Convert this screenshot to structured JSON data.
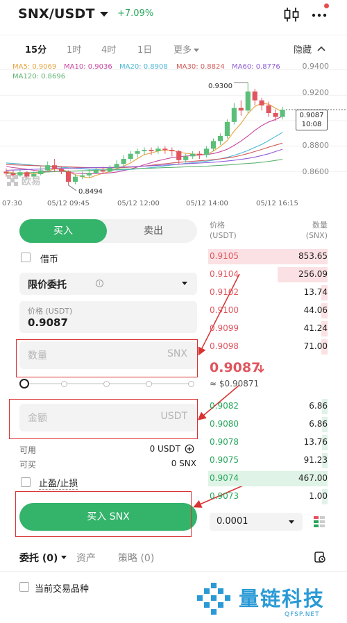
{
  "header": {
    "pair": "SNX/USDT",
    "change": "+7.09%",
    "colors": {
      "up": "#26a65b",
      "down": "#e0555e",
      "accent": "#34b36a"
    }
  },
  "timeframes": {
    "items": [
      "15分",
      "1时",
      "4时",
      "1日",
      "更多"
    ],
    "active": "15分",
    "hide_label": "隐藏"
  },
  "indicators": {
    "ma5": "MA5: 0.9069",
    "ma10": "MA10: 0.9036",
    "ma20": "MA20: 0.8908",
    "ma30": "MA30: 0.8824",
    "ma60": "MA60: 0.8776",
    "ma120": "MA120: 0.8696"
  },
  "chart_data": {
    "type": "candlestick",
    "price_ticks": [
      "0.9400",
      "0.9200",
      "0.9000",
      "0.8800",
      "0.8600"
    ],
    "time_ticks": [
      "07:30",
      "05/12 09:45",
      "05/12 12:00",
      "05/12 14:00",
      "05/12 16:15"
    ],
    "ylim": [
      0.84,
      0.948
    ],
    "high_label": "0.9300",
    "low_label": "0.8494",
    "current_price": "0.9087",
    "countdown": "10:08",
    "watermark": "欧易",
    "candles": [
      [
        0.86,
        0.8585,
        0.8625,
        0.856
      ],
      [
        0.8585,
        0.857,
        0.861,
        0.855
      ],
      [
        0.857,
        0.8595,
        0.862,
        0.856
      ],
      [
        0.8595,
        0.856,
        0.8605,
        0.854
      ],
      [
        0.856,
        0.858,
        0.86,
        0.8545
      ],
      [
        0.858,
        0.861,
        0.864,
        0.857
      ],
      [
        0.861,
        0.865,
        0.868,
        0.86
      ],
      [
        0.865,
        0.862,
        0.87,
        0.86
      ],
      [
        0.862,
        0.86,
        0.864,
        0.858
      ],
      [
        0.86,
        0.852,
        0.861,
        0.8494
      ],
      [
        0.852,
        0.856,
        0.858,
        0.85
      ],
      [
        0.856,
        0.857,
        0.86,
        0.854
      ],
      [
        0.857,
        0.859,
        0.862,
        0.855
      ],
      [
        0.859,
        0.861,
        0.863,
        0.858
      ],
      [
        0.861,
        0.86,
        0.864,
        0.858
      ],
      [
        0.86,
        0.863,
        0.865,
        0.859
      ],
      [
        0.863,
        0.866,
        0.869,
        0.861
      ],
      [
        0.866,
        0.87,
        0.873,
        0.864
      ],
      [
        0.87,
        0.874,
        0.876,
        0.868
      ],
      [
        0.874,
        0.876,
        0.878,
        0.871
      ],
      [
        0.876,
        0.877,
        0.879,
        0.873
      ],
      [
        0.877,
        0.876,
        0.879,
        0.873
      ],
      [
        0.876,
        0.878,
        0.88,
        0.874
      ],
      [
        0.878,
        0.877,
        0.88,
        0.874
      ],
      [
        0.877,
        0.876,
        0.879,
        0.872
      ],
      [
        0.876,
        0.869,
        0.877,
        0.866
      ],
      [
        0.869,
        0.872,
        0.874,
        0.867
      ],
      [
        0.872,
        0.874,
        0.876,
        0.87
      ],
      [
        0.874,
        0.873,
        0.876,
        0.87
      ],
      [
        0.873,
        0.878,
        0.88,
        0.871
      ],
      [
        0.878,
        0.884,
        0.886,
        0.876
      ],
      [
        0.884,
        0.888,
        0.89,
        0.881
      ],
      [
        0.888,
        0.899,
        0.901,
        0.886
      ],
      [
        0.899,
        0.91,
        0.914,
        0.897
      ],
      [
        0.91,
        0.908,
        0.916,
        0.904
      ],
      [
        0.908,
        0.923,
        0.93,
        0.906
      ],
      [
        0.923,
        0.916,
        0.925,
        0.912
      ],
      [
        0.916,
        0.912,
        0.918,
        0.908
      ],
      [
        0.912,
        0.906,
        0.915,
        0.903
      ],
      [
        0.906,
        0.903,
        0.909,
        0.9
      ],
      [
        0.903,
        0.9087,
        0.911,
        0.901
      ]
    ],
    "ma_lines": [
      {
        "color": "#e7a33e",
        "values": [
          0.86,
          0.859,
          0.8585,
          0.8585,
          0.8582,
          0.8583,
          0.8603,
          0.8622,
          0.8616,
          0.86,
          0.8574,
          0.856,
          0.855,
          0.857,
          0.8586,
          0.86,
          0.8622,
          0.8642,
          0.8668,
          0.8702,
          0.8734,
          0.8746,
          0.8762,
          0.8768,
          0.8768,
          0.8752,
          0.8744,
          0.8738,
          0.8736,
          0.8732,
          0.8762,
          0.8798,
          0.8844,
          0.8918,
          0.8978,
          0.9056,
          0.9112,
          0.9138,
          0.913,
          0.9098,
          0.9069
        ]
      },
      {
        "color": "#c845a0",
        "values": [
          0.864,
          0.8632,
          0.8625,
          0.8618,
          0.861,
          0.8604,
          0.86,
          0.8602,
          0.8603,
          0.8595,
          0.8588,
          0.8585,
          0.8582,
          0.8585,
          0.8586,
          0.859,
          0.8597,
          0.8608,
          0.862,
          0.8636,
          0.8654,
          0.867,
          0.8685,
          0.8698,
          0.871,
          0.8718,
          0.8722,
          0.8726,
          0.873,
          0.8734,
          0.8742,
          0.8756,
          0.8776,
          0.8806,
          0.884,
          0.888,
          0.8924,
          0.8962,
          0.899,
          0.901,
          0.9036
        ]
      },
      {
        "color": "#4bb7d6",
        "values": [
          0.8668,
          0.8664,
          0.866,
          0.8655,
          0.865,
          0.8646,
          0.8642,
          0.8638,
          0.8634,
          0.863,
          0.8626,
          0.8622,
          0.8618,
          0.8616,
          0.8614,
          0.8613,
          0.8613,
          0.8614,
          0.8617,
          0.8621,
          0.8626,
          0.8632,
          0.8638,
          0.8645,
          0.8652,
          0.8658,
          0.8664,
          0.867,
          0.8676,
          0.8682,
          0.869,
          0.87,
          0.8712,
          0.8728,
          0.8746,
          0.8766,
          0.879,
          0.8814,
          0.8844,
          0.8876,
          0.8908
        ]
      },
      {
        "color": "#d05a5a",
        "values": [
          0.8655,
          0.8653,
          0.8651,
          0.8649,
          0.8647,
          0.8645,
          0.8643,
          0.8641,
          0.8639,
          0.8637,
          0.8635,
          0.8633,
          0.8631,
          0.863,
          0.8629,
          0.8629,
          0.863,
          0.8632,
          0.8635,
          0.8639,
          0.8644,
          0.865,
          0.8656,
          0.8662,
          0.8668,
          0.8673,
          0.8677,
          0.8681,
          0.8685,
          0.8689,
          0.8694,
          0.87,
          0.8707,
          0.8716,
          0.8728,
          0.8742,
          0.8758,
          0.8774,
          0.8792,
          0.8808,
          0.8824
        ]
      },
      {
        "color": "#8f5ad6",
        "values": [
          0.861,
          0.8612,
          0.8614,
          0.8616,
          0.8618,
          0.862,
          0.8622,
          0.8624,
          0.8626,
          0.8627,
          0.8628,
          0.8629,
          0.863,
          0.8631,
          0.8632,
          0.8633,
          0.8634,
          0.8636,
          0.8638,
          0.864,
          0.8643,
          0.8646,
          0.8649,
          0.8652,
          0.8655,
          0.8658,
          0.8661,
          0.8664,
          0.8667,
          0.867,
          0.8674,
          0.8678,
          0.8683,
          0.8689,
          0.8696,
          0.8704,
          0.8714,
          0.8726,
          0.874,
          0.8758,
          0.8776
        ]
      },
      {
        "color": "#5fb36f",
        "values": [
          0.8585,
          0.8587,
          0.8589,
          0.8591,
          0.8593,
          0.8595,
          0.8597,
          0.8599,
          0.8601,
          0.8603,
          0.8605,
          0.8607,
          0.8609,
          0.8611,
          0.8613,
          0.8615,
          0.8617,
          0.8619,
          0.8621,
          0.8623,
          0.8625,
          0.8627,
          0.8629,
          0.8631,
          0.8633,
          0.8635,
          0.8637,
          0.8639,
          0.8641,
          0.8643,
          0.8646,
          0.8649,
          0.8652,
          0.8656,
          0.866,
          0.8664,
          0.8668,
          0.8674,
          0.868,
          0.8688,
          0.8696
        ]
      }
    ]
  },
  "order_form": {
    "buy_tab": "买入",
    "sell_tab": "卖出",
    "borrow_label": "借币",
    "order_type": "限价委托",
    "price_label": "价格 (USDT)",
    "price_value": "0.9087",
    "qty_placeholder": "数量",
    "qty_unit": "SNX",
    "amount_placeholder": "金额",
    "amount_unit": "USDT",
    "available_label": "可用",
    "available_value": "0 USDT",
    "buyable_label": "可买",
    "buyable_value": "0 SNX",
    "tpsl_label": "止盈/止损",
    "submit_label": "买入 SNX"
  },
  "order_book": {
    "price_header": "价格",
    "price_unit": "(USDT)",
    "qty_header": "数量",
    "qty_unit": "(SNX)",
    "asks": [
      {
        "price": "0.9105",
        "qty": "853.65",
        "depth": 1.0
      },
      {
        "price": "0.9104",
        "qty": "256.09",
        "depth": 0.42
      },
      {
        "price": "0.9102",
        "qty": "13.74",
        "depth": 0.05
      },
      {
        "price": "0.9100",
        "qty": "44.06",
        "depth": 0.05
      },
      {
        "price": "0.9099",
        "qty": "41.24",
        "depth": 0.05
      },
      {
        "price": "0.9098",
        "qty": "71.00",
        "depth": 0.05
      }
    ],
    "mid_price": "0.9087",
    "mid_fiat": "≈ $0.90871",
    "bids": [
      {
        "price": "0.9082",
        "qty": "6.86",
        "depth": 0.03
      },
      {
        "price": "0.9080",
        "qty": "6.86",
        "depth": 0.03
      },
      {
        "price": "0.9078",
        "qty": "13.76",
        "depth": 0.03
      },
      {
        "price": "0.9075",
        "qty": "91.23",
        "depth": 0.03
      },
      {
        "price": "0.9074",
        "qty": "467.00",
        "depth": 1.0
      },
      {
        "price": "0.9073",
        "qty": "1.00",
        "depth": 0.03
      }
    ],
    "precision": "0.0001"
  },
  "bottom": {
    "tab_orders": "委托 (0)",
    "tab_assets": "资产",
    "tab_strategy": "策略 (0)",
    "current_only_label": "当前交易品种",
    "brand": "量链科技",
    "brand_sub": "QFSP.NET"
  }
}
